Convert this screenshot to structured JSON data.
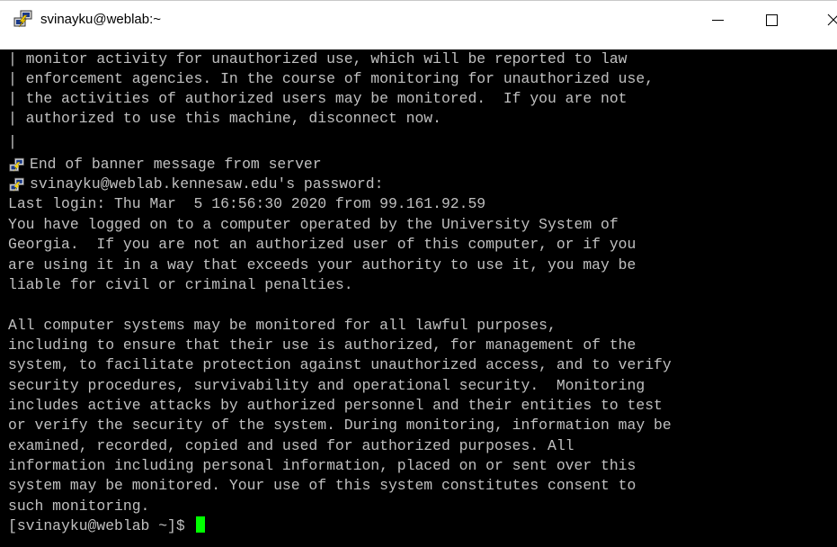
{
  "window": {
    "title": "svinayku@weblab:~",
    "icon": "putty-icon"
  },
  "title_bar_controls": {
    "minimize_icon": "minimize-icon",
    "maximize_icon": "maximize-icon",
    "close_icon": "close-icon"
  },
  "terminal": {
    "banner_lines": [
      "| monitor activity for unauthorized use, which will be reported to law",
      "| enforcement agencies. In the course of monitoring for unauthorized use,",
      "| the activities of authorized users may be monitored.  If you are not",
      "| authorized to use this machine, disconnect now.",
      "|"
    ],
    "end_of_banner": "End of banner message from server",
    "password_prompt": "svinayku@weblab.kennesaw.edu's password:",
    "last_login": "Last login: Thu Mar  5 16:56:30 2020 from 99.161.92.59",
    "notice_lines": [
      "You have logged on to a computer operated by the University System of",
      "Georgia.  If you are not an authorized user of this computer, or if you",
      "are using it in a way that exceeds your authority to use it, you may be",
      "liable for civil or criminal penalties.",
      "",
      "All computer systems may be monitored for all lawful purposes,",
      "including to ensure that their use is authorized, for management of the",
      "system, to facilitate protection against unauthorized access, and to verify",
      "security procedures, survivability and operational security.  Monitoring",
      "includes active attacks by authorized personnel and their entities to test",
      "or verify the security of the system. During monitoring, information may be",
      "examined, recorded, copied and used for authorized purposes. All",
      "information including personal information, placed on or sent over this",
      "system may be monitored. Your use of this system constitutes consent to",
      "such monitoring."
    ],
    "prompt": "[svinayku@weblab ~]$ ",
    "colors": {
      "background": "#000000",
      "foreground": "#c0c0c0",
      "cursor": "#00ff00"
    }
  }
}
